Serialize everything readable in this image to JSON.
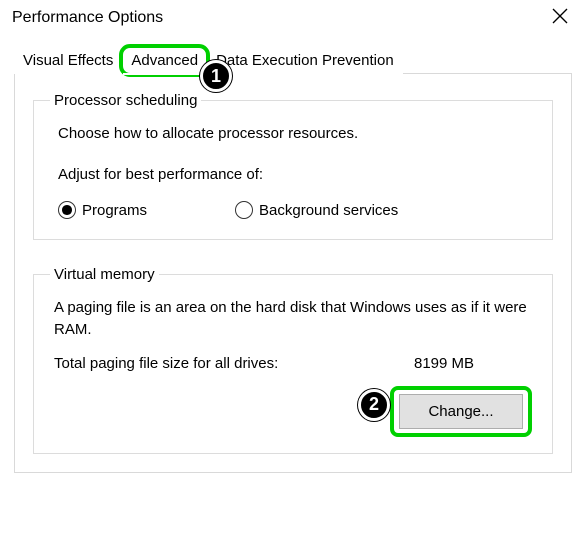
{
  "window": {
    "title": "Performance Options"
  },
  "tabs": {
    "visual_effects": "Visual Effects",
    "advanced": "Advanced",
    "dep": "Data Execution Prevention"
  },
  "markers": {
    "one": "1",
    "two": "2"
  },
  "processor": {
    "legend": "Processor scheduling",
    "desc": "Choose how to allocate processor resources.",
    "subhead": "Adjust for best performance of:",
    "programs": "Programs",
    "background": "Background services"
  },
  "virtual_memory": {
    "legend": "Virtual memory",
    "desc": "A paging file is an area on the hard disk that Windows uses as if it were RAM.",
    "total_label": "Total paging file size for all drives:",
    "total_value": "8199 MB",
    "change_btn": "Change..."
  }
}
